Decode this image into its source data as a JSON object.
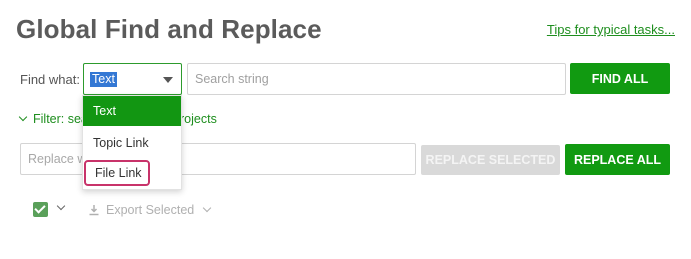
{
  "header": {
    "title": "Global Find and Replace",
    "tips_link": "Tips for typical tasks..."
  },
  "find": {
    "label": "Find what:",
    "type_selected": "Text",
    "search_placeholder": "Search string",
    "find_all_label": "FIND ALL"
  },
  "type_dropdown": {
    "options": [
      {
        "label": "Text",
        "selected": true
      },
      {
        "label": "Topic Link",
        "selected": false
      },
      {
        "label": "File Link",
        "selected": false,
        "highlighted": true
      }
    ]
  },
  "filter": {
    "label_left": "Filter: sea",
    "label_right": "rojects"
  },
  "replace": {
    "placeholder": "Replace w",
    "replace_selected_label": "REPLACE SELECTED",
    "replace_all_label": "REPLACE ALL"
  },
  "results_toolbar": {
    "select_all_checked": true,
    "export_label": "Export Selected"
  },
  "colors": {
    "accent": "#119a11",
    "link": "#1e8e1e",
    "disabled_button": "#d9d9d9",
    "highlight_outline": "#c8336a"
  }
}
